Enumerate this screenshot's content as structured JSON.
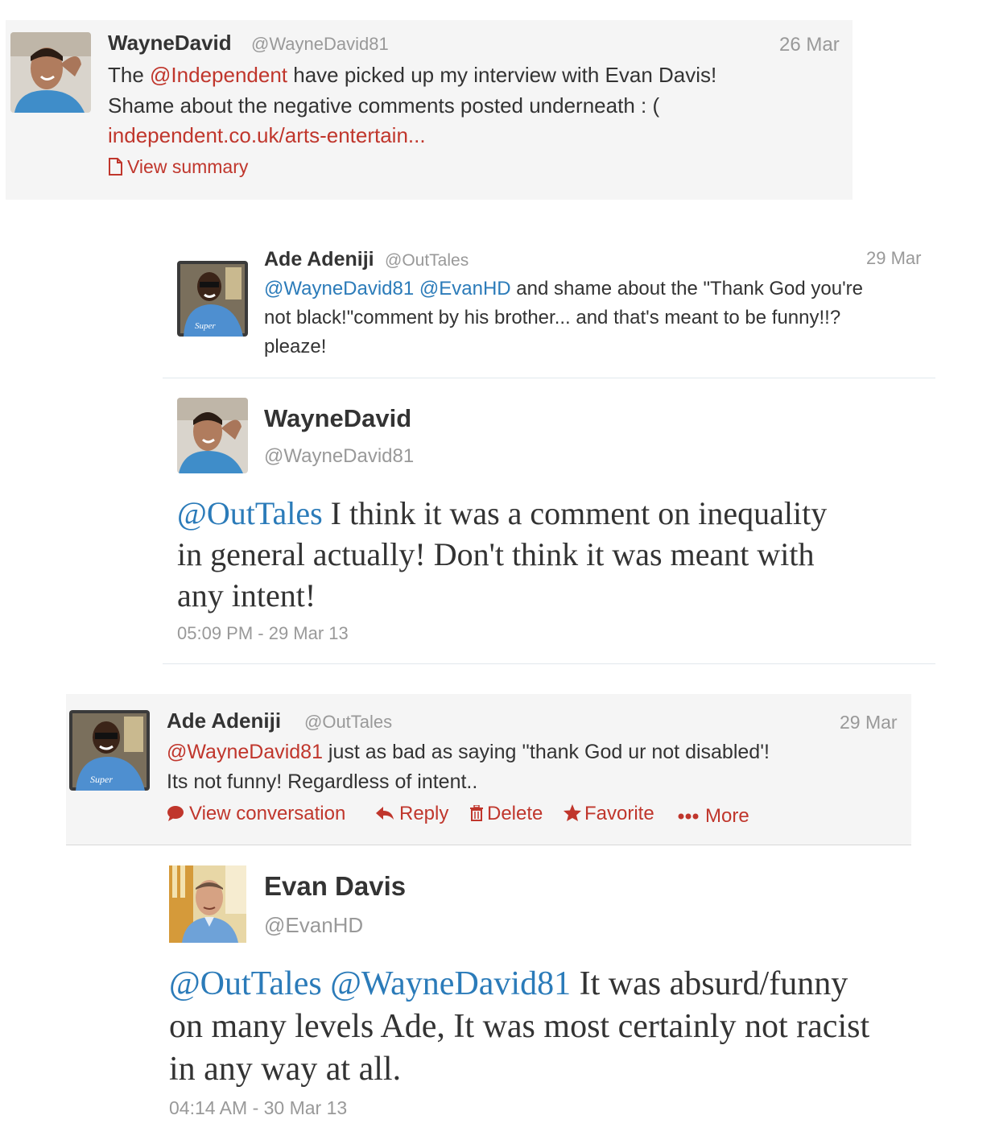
{
  "tweet1": {
    "name": "WayneDavid",
    "handle": "@WayneDavid81",
    "date": "26 Mar",
    "mention": "@Independent",
    "text_a": "The ",
    "text_b": " have picked up my interview with Evan Davis!",
    "line2": "Shame about the negative comments posted underneath : (",
    "link": "independent.co.uk/arts-entertain...",
    "summary_icon": "document-icon",
    "summary_label": "View summary"
  },
  "reply1": {
    "name": "Ade Adeniji",
    "handle": "@OutTales",
    "date": "29 Mar",
    "mention1": "@WayneDavid81",
    "mention2": "@EvanHD",
    "line1_rest": " and shame about the \"Thank God you're",
    "line2": "not black!\"comment by his brother... and that's meant to be funny!!?",
    "line3": "pleaze!"
  },
  "focus1": {
    "name": "WayneDavid",
    "handle": "@WayneDavid81",
    "mention": "@OutTales",
    "line1_rest": " I think it was a comment on inequality",
    "line2": "in general actually! Don't think it was meant with",
    "line3": "any intent!",
    "timestamp": "05:09 PM - 29 Mar 13"
  },
  "tweet2": {
    "name": "Ade Adeniji",
    "handle": "@OutTales",
    "date": "29 Mar",
    "mention": "@WayneDavid81",
    "line1_rest": " just as bad as saying ''thank God ur not disabled'!",
    "line2": "Its not funny! Regardless of intent..",
    "actions": {
      "view_conversation": "View conversation",
      "reply": "Reply",
      "delete": "Delete",
      "favorite": "Favorite",
      "more": "More"
    }
  },
  "focus2": {
    "name": "Evan Davis",
    "handle": "@EvanHD",
    "mention1": "@OutTales",
    "mention2": "@WayneDavid81",
    "line1_rest": " It was absurd/funny",
    "line2": "on many levels Ade, It was most certainly not racist",
    "line3": "in any way at all.",
    "timestamp": "04:14 AM - 30 Mar 13"
  },
  "colors": {
    "link_red": "#c0362c",
    "link_blue": "#2b7bb9",
    "panel": "#f5f5f5",
    "muted": "#999999"
  }
}
